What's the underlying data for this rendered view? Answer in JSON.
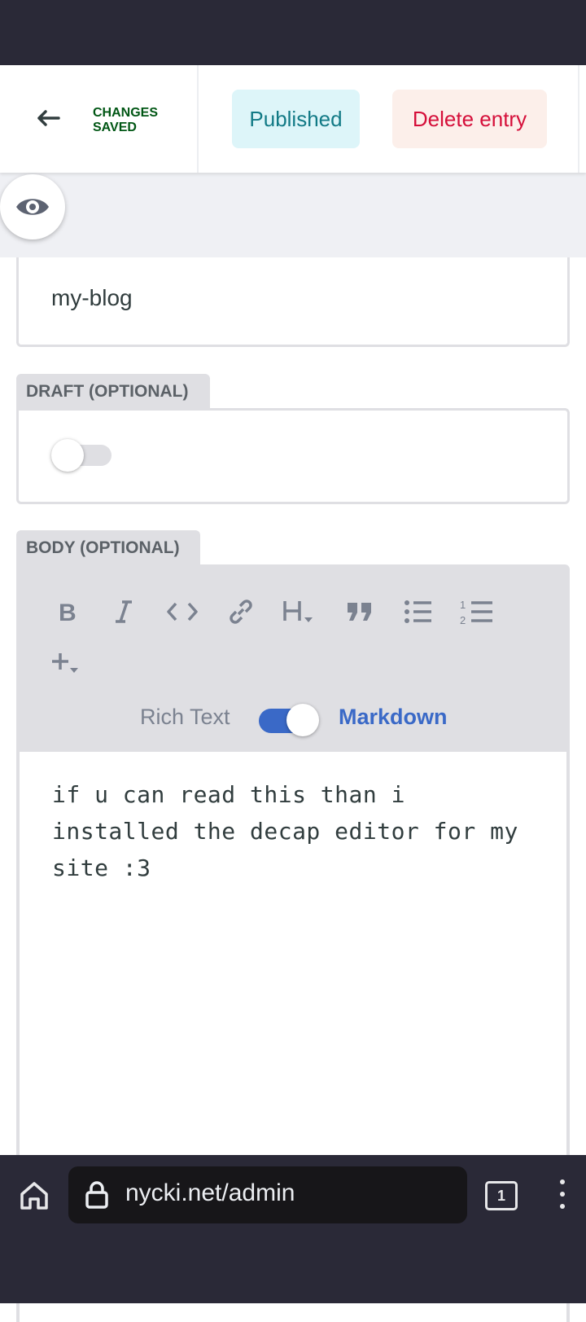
{
  "header": {
    "back_icon": "arrow-left-icon",
    "save_status": "CHANGES SAVED",
    "published_label": "Published",
    "delete_label": "Delete entry"
  },
  "preview": {
    "icon": "eye-icon"
  },
  "fields": {
    "slug": {
      "value": "my-blog"
    },
    "draft": {
      "label": "DRAFT (OPTIONAL)",
      "enabled": false
    },
    "body": {
      "label": "BODY (OPTIONAL)",
      "toolbar": [
        "bold-icon",
        "italic-icon",
        "code-icon",
        "link-icon",
        "heading-dropdown-icon",
        "quote-icon",
        "bulleted-list-icon",
        "numbered-list-icon",
        "add-component-icon"
      ],
      "mode_rich": "Rich Text",
      "mode_markdown": "Markdown",
      "markdown_enabled": true,
      "content": "if u can read this than i installed the decap editor for my site :3"
    }
  },
  "browser": {
    "url": "nycki.net/admin",
    "tab_count": "1",
    "home_icon": "home-icon",
    "lock_icon": "lock-icon",
    "menu_icon": "more-vert-icon"
  },
  "colors": {
    "accent": "#3a69c7",
    "saved": "#005614",
    "published_bg": "#ddf5f9",
    "delete_text": "#d50f3a",
    "chrome": "#2a2937"
  }
}
